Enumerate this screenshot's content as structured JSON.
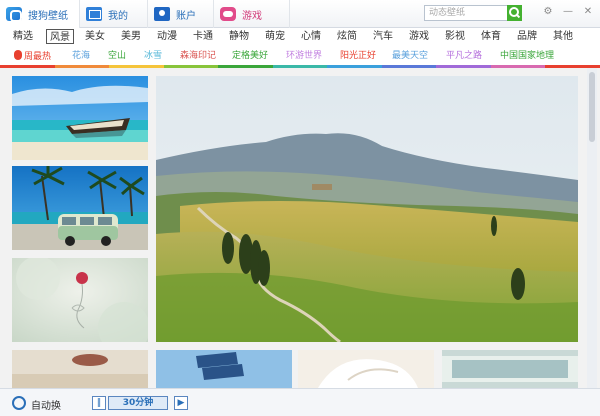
{
  "header": {
    "tabs": [
      {
        "label": "搜狗壁纸",
        "icon": "sogou-logo-icon"
      },
      {
        "label": "我的",
        "icon": "monitor-icon"
      },
      {
        "label": "账户",
        "icon": "account-icon"
      },
      {
        "label": "游戏",
        "icon": "gamepad-icon"
      }
    ],
    "search_placeholder": "动态壁纸",
    "window_buttons": {
      "settings": "⚙",
      "minimize": "—",
      "close": "✕"
    }
  },
  "categories": [
    "精选",
    "风景",
    "美女",
    "美男",
    "动漫",
    "卡通",
    "静物",
    "萌宠",
    "心情",
    "炫简",
    "汽车",
    "游戏",
    "影视",
    "体育",
    "品牌",
    "其他"
  ],
  "active_category": "风景",
  "subcategories": [
    {
      "label": "周最热",
      "color": "#e8402f"
    },
    {
      "label": "花海",
      "color": "#5aa0dc"
    },
    {
      "label": "空山",
      "color": "#3aa63a"
    },
    {
      "label": "冰雪",
      "color": "#58b8d8"
    },
    {
      "label": "森海印记",
      "color": "#d9534f"
    },
    {
      "label": "定格美好",
      "color": "#3aa63a"
    },
    {
      "label": "环游世界",
      "color": "#c280e0"
    },
    {
      "label": "阳光正好",
      "color": "#e8402f"
    },
    {
      "label": "最美天空",
      "color": "#5aa0dc"
    },
    {
      "label": "平凡之路",
      "color": "#b46edc"
    },
    {
      "label": "中国国家地理",
      "color": "#3aa63a"
    }
  ],
  "colorbar": [
    "#e8402f",
    "#f08a3a",
    "#f5c43a",
    "#88c43a",
    "#3aa63a",
    "#3ab8a8",
    "#3aa0dc",
    "#5a78d8",
    "#a06ad8",
    "#d86ab0",
    "#e8402f"
  ],
  "images": [
    {
      "name": "beach-boat-thumbnail"
    },
    {
      "name": "beach-van-thumbnail"
    },
    {
      "name": "balloon-thumbnail"
    },
    {
      "name": "tuscany-hills-featured"
    },
    {
      "name": "bicycle-thumbnail"
    },
    {
      "name": "subway-sign-thumbnail"
    },
    {
      "name": "white-object-thumbnail"
    },
    {
      "name": "window-thumbnail"
    }
  ],
  "bottom": {
    "auto_label": "自动换",
    "timer": "30分钟",
    "prev": "◀",
    "pause": "‖",
    "next": "▶"
  }
}
